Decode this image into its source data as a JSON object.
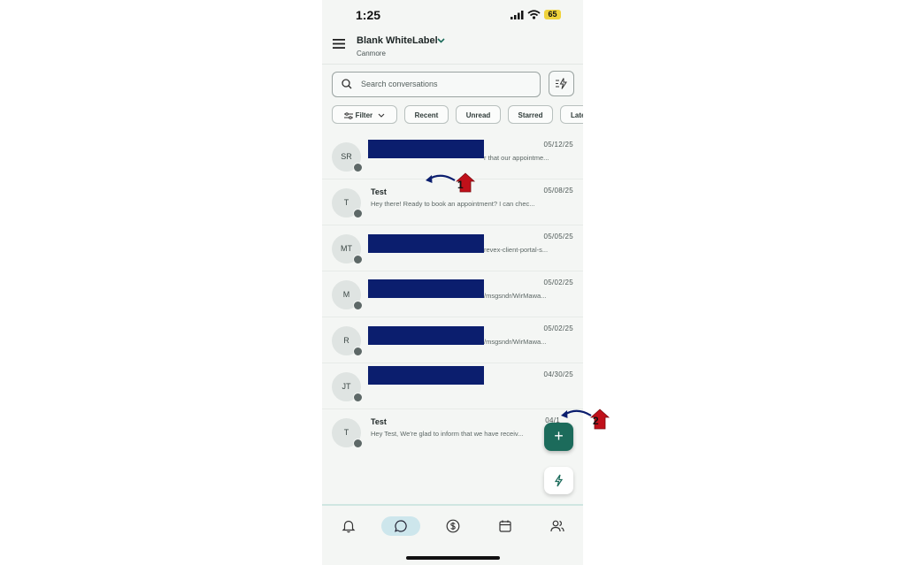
{
  "status_bar": {
    "time": "1:25",
    "battery": "65"
  },
  "header": {
    "account_name": "Blank WhiteLabel",
    "location": "Canmore"
  },
  "search": {
    "placeholder": "Search conversations"
  },
  "filters": [
    {
      "label": "Filter"
    },
    {
      "label": "Recent"
    },
    {
      "label": "Unread"
    },
    {
      "label": "Starred"
    },
    {
      "label": "Late"
    }
  ],
  "conversations": [
    {
      "initials": "SR",
      "name": "",
      "date": "05/12/25",
      "preview": "r that our appointme...",
      "redacted": true
    },
    {
      "initials": "T",
      "name": "Test",
      "date": "05/08/25",
      "preview": "Hey there! Ready to book an appointment? I can chec...",
      "redacted": false
    },
    {
      "initials": "MT",
      "name": "",
      "date": "05/05/25",
      "preview": "revex-client-portal-s...",
      "redacted": true
    },
    {
      "initials": "M",
      "name": "",
      "date": "05/02/25",
      "preview": "/msgsndr/WirMawa...",
      "redacted": true
    },
    {
      "initials": "R",
      "name": "",
      "date": "05/02/25",
      "preview": "/msgsndr/WirMawa...",
      "redacted": true
    },
    {
      "initials": "JT",
      "name": "",
      "date": "04/30/25",
      "preview": "",
      "redacted": true
    },
    {
      "initials": "T",
      "name": "Test",
      "date": "04/1",
      "preview": "Hey Test, We're glad to inform that we have receiv...",
      "redacted": false
    }
  ],
  "annotations": [
    {
      "number": "1"
    },
    {
      "number": "2"
    }
  ],
  "fab": {
    "label": "+"
  },
  "tabbar": [
    {
      "icon": "bell-icon",
      "active": false
    },
    {
      "icon": "chat-icon",
      "active": true
    },
    {
      "icon": "dollar-icon",
      "active": false
    },
    {
      "icon": "calendar-icon",
      "active": false
    },
    {
      "icon": "contacts-icon",
      "active": false
    }
  ],
  "colors": {
    "accent": "#1c6b5b",
    "redaction": "#0b1e6e",
    "annotation": "#c0101a"
  }
}
